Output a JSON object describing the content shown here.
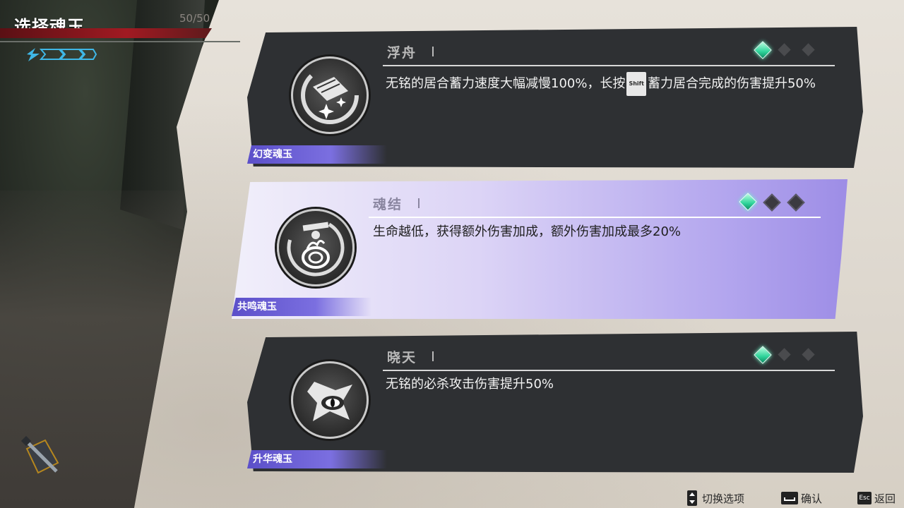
{
  "hud": {
    "title": "选择魂玉",
    "hp_text": "50/50",
    "hp_fraction": 1.0
  },
  "cards": [
    {
      "name": "浮舟",
      "tier": "I",
      "desc_before": "无铭的居合蓄力速度大幅减慢100%，长按",
      "key": "Shift",
      "desc_after": "蓄力居合完成的伤害提升50%",
      "category": "幻变魂玉",
      "level": 1,
      "max_level": 3,
      "selected": false,
      "icon": "boat-icon"
    },
    {
      "name": "魂结",
      "tier": "I",
      "desc": "生命越低，获得额外伤害加成，额外伤害加成最多20%",
      "category": "共鸣魂玉",
      "level": 1,
      "max_level": 3,
      "selected": true,
      "icon": "flame-knot-icon"
    },
    {
      "name": "晓天",
      "tier": "I",
      "desc": "无铭的必杀攻击伤害提升50%",
      "category": "升华魂玉",
      "level": 1,
      "max_level": 3,
      "selected": false,
      "icon": "star-eye-icon"
    }
  ],
  "footer": {
    "switch_label": "切换选项",
    "confirm_label": "确认",
    "back_label": "返回",
    "esc_key": "Esc"
  },
  "colors": {
    "gem_active": "#2ed39a",
    "selected_card": "#b3a6ee",
    "tag": "#6a5fd6"
  }
}
